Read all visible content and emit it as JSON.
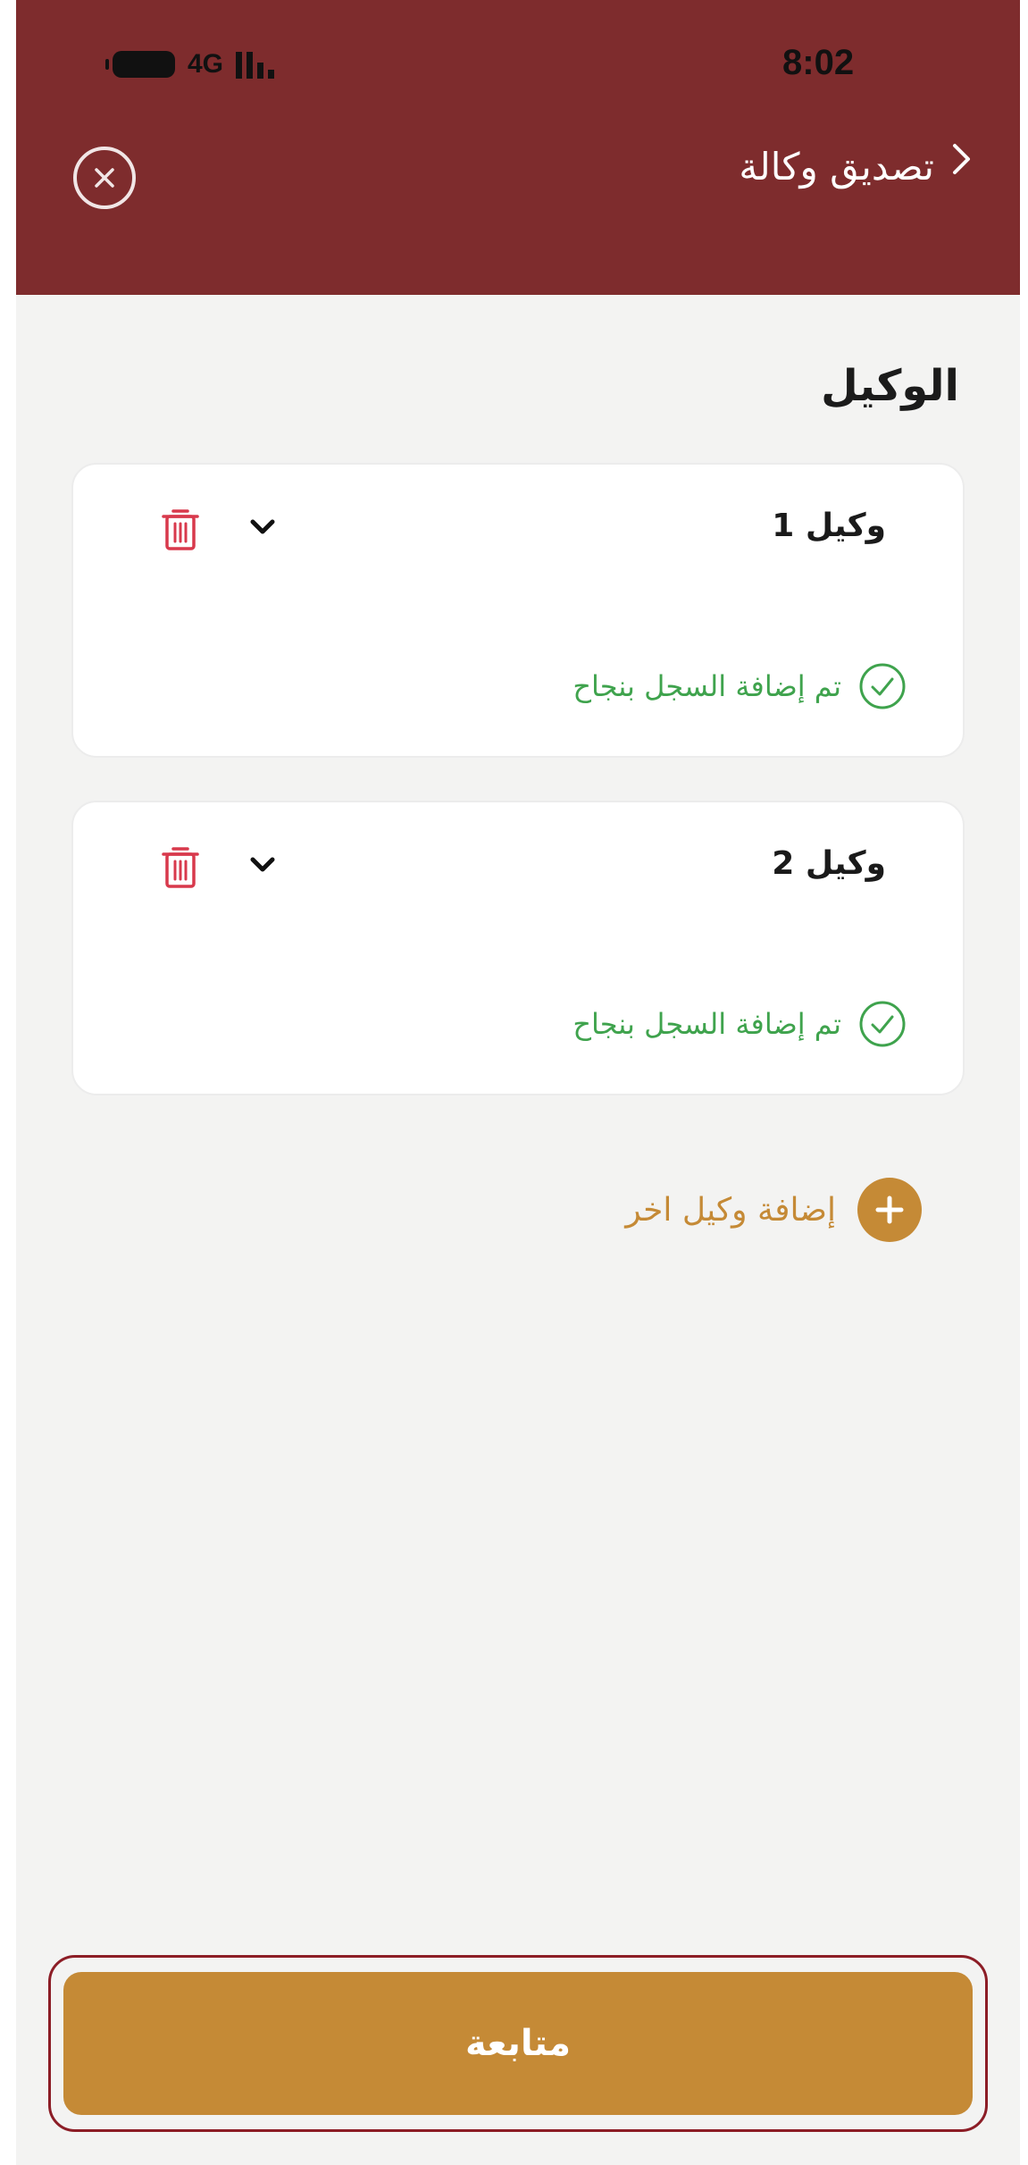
{
  "status_bar": {
    "network": "4G",
    "time": "8:02"
  },
  "header": {
    "title": "تصديق وكالة",
    "back_icon": "chevron-right-icon",
    "close_icon": "close-circle-icon"
  },
  "section": {
    "title": "الوكيل"
  },
  "agents": [
    {
      "title": "وكيل 1",
      "status": "تم إضافة السجل بنجاح"
    },
    {
      "title": "وكيل 2",
      "status": "تم إضافة السجل بنجاح"
    }
  ],
  "add_agent": {
    "label": "إضافة وكيل اخر",
    "icon": "plus-circle-icon"
  },
  "footer": {
    "continue_label": "متابعة"
  },
  "colors": {
    "header_bg": "#7e2c2d",
    "accent": "#c58a36",
    "success": "#3fa34d",
    "delete": "#d8394c"
  }
}
